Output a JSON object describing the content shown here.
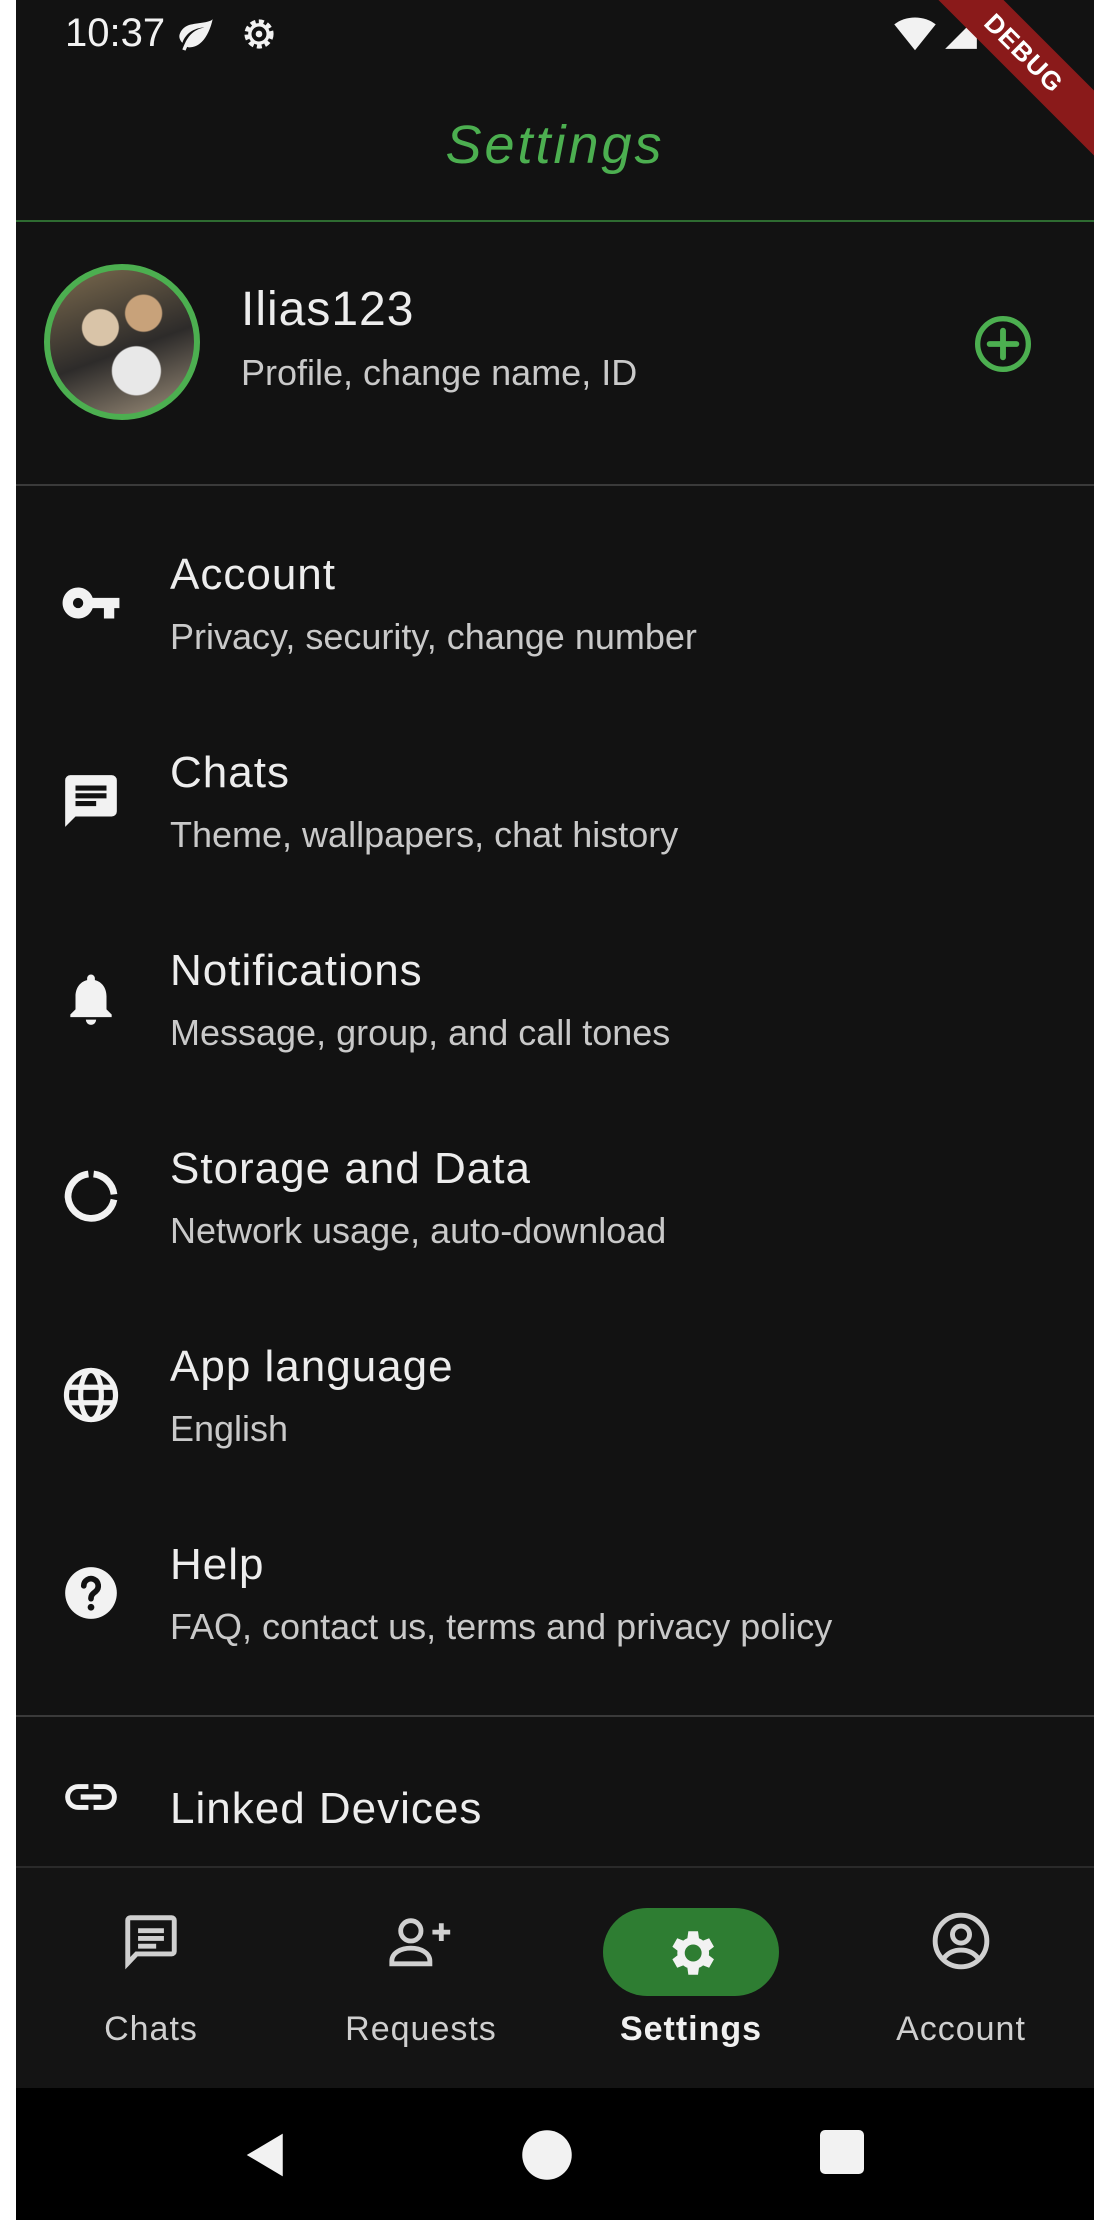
{
  "status_bar": {
    "time": "10:37",
    "left_icons": [
      "leaf-icon",
      "settings-gear-icon"
    ],
    "right_icons": [
      "wifi-icon",
      "signal-icon",
      "battery-icon"
    ],
    "debug_banner": "DEBUG"
  },
  "app_bar": {
    "title": "Settings"
  },
  "profile": {
    "name": "Ilias123",
    "subtitle": "Profile, change name, ID",
    "action_icon": "add-circle-icon"
  },
  "settings_items": [
    {
      "title": "Account",
      "subtitle": "Privacy, security, change number",
      "icon": "key-icon"
    },
    {
      "title": "Chats",
      "subtitle": "Theme, wallpapers, chat history",
      "icon": "chat-icon"
    },
    {
      "title": "Notifications",
      "subtitle": "Message, group, and call tones",
      "icon": "bell-icon"
    },
    {
      "title": "Storage and Data",
      "subtitle": "Network usage, auto-download",
      "icon": "data-usage-icon"
    },
    {
      "title": "App language",
      "subtitle": "English",
      "icon": "globe-icon"
    },
    {
      "title": "Help",
      "subtitle": "FAQ, contact us, terms and privacy policy",
      "icon": "help-icon"
    }
  ],
  "linked_devices": {
    "title": "Linked Devices",
    "icon": "link-icon"
  },
  "bottom_nav": {
    "items": [
      {
        "label": "Chats",
        "icon": "chat-icon",
        "active": false
      },
      {
        "label": "Requests",
        "icon": "person-add-icon",
        "active": false
      },
      {
        "label": "Settings",
        "icon": "gear-icon",
        "active": true
      },
      {
        "label": "Account",
        "icon": "account-circle-icon",
        "active": false
      }
    ]
  },
  "colors": {
    "accent": "#4caf50",
    "accent_dark": "#2e7d32",
    "background": "#121212",
    "debug_banner": "#8a1a1a"
  }
}
